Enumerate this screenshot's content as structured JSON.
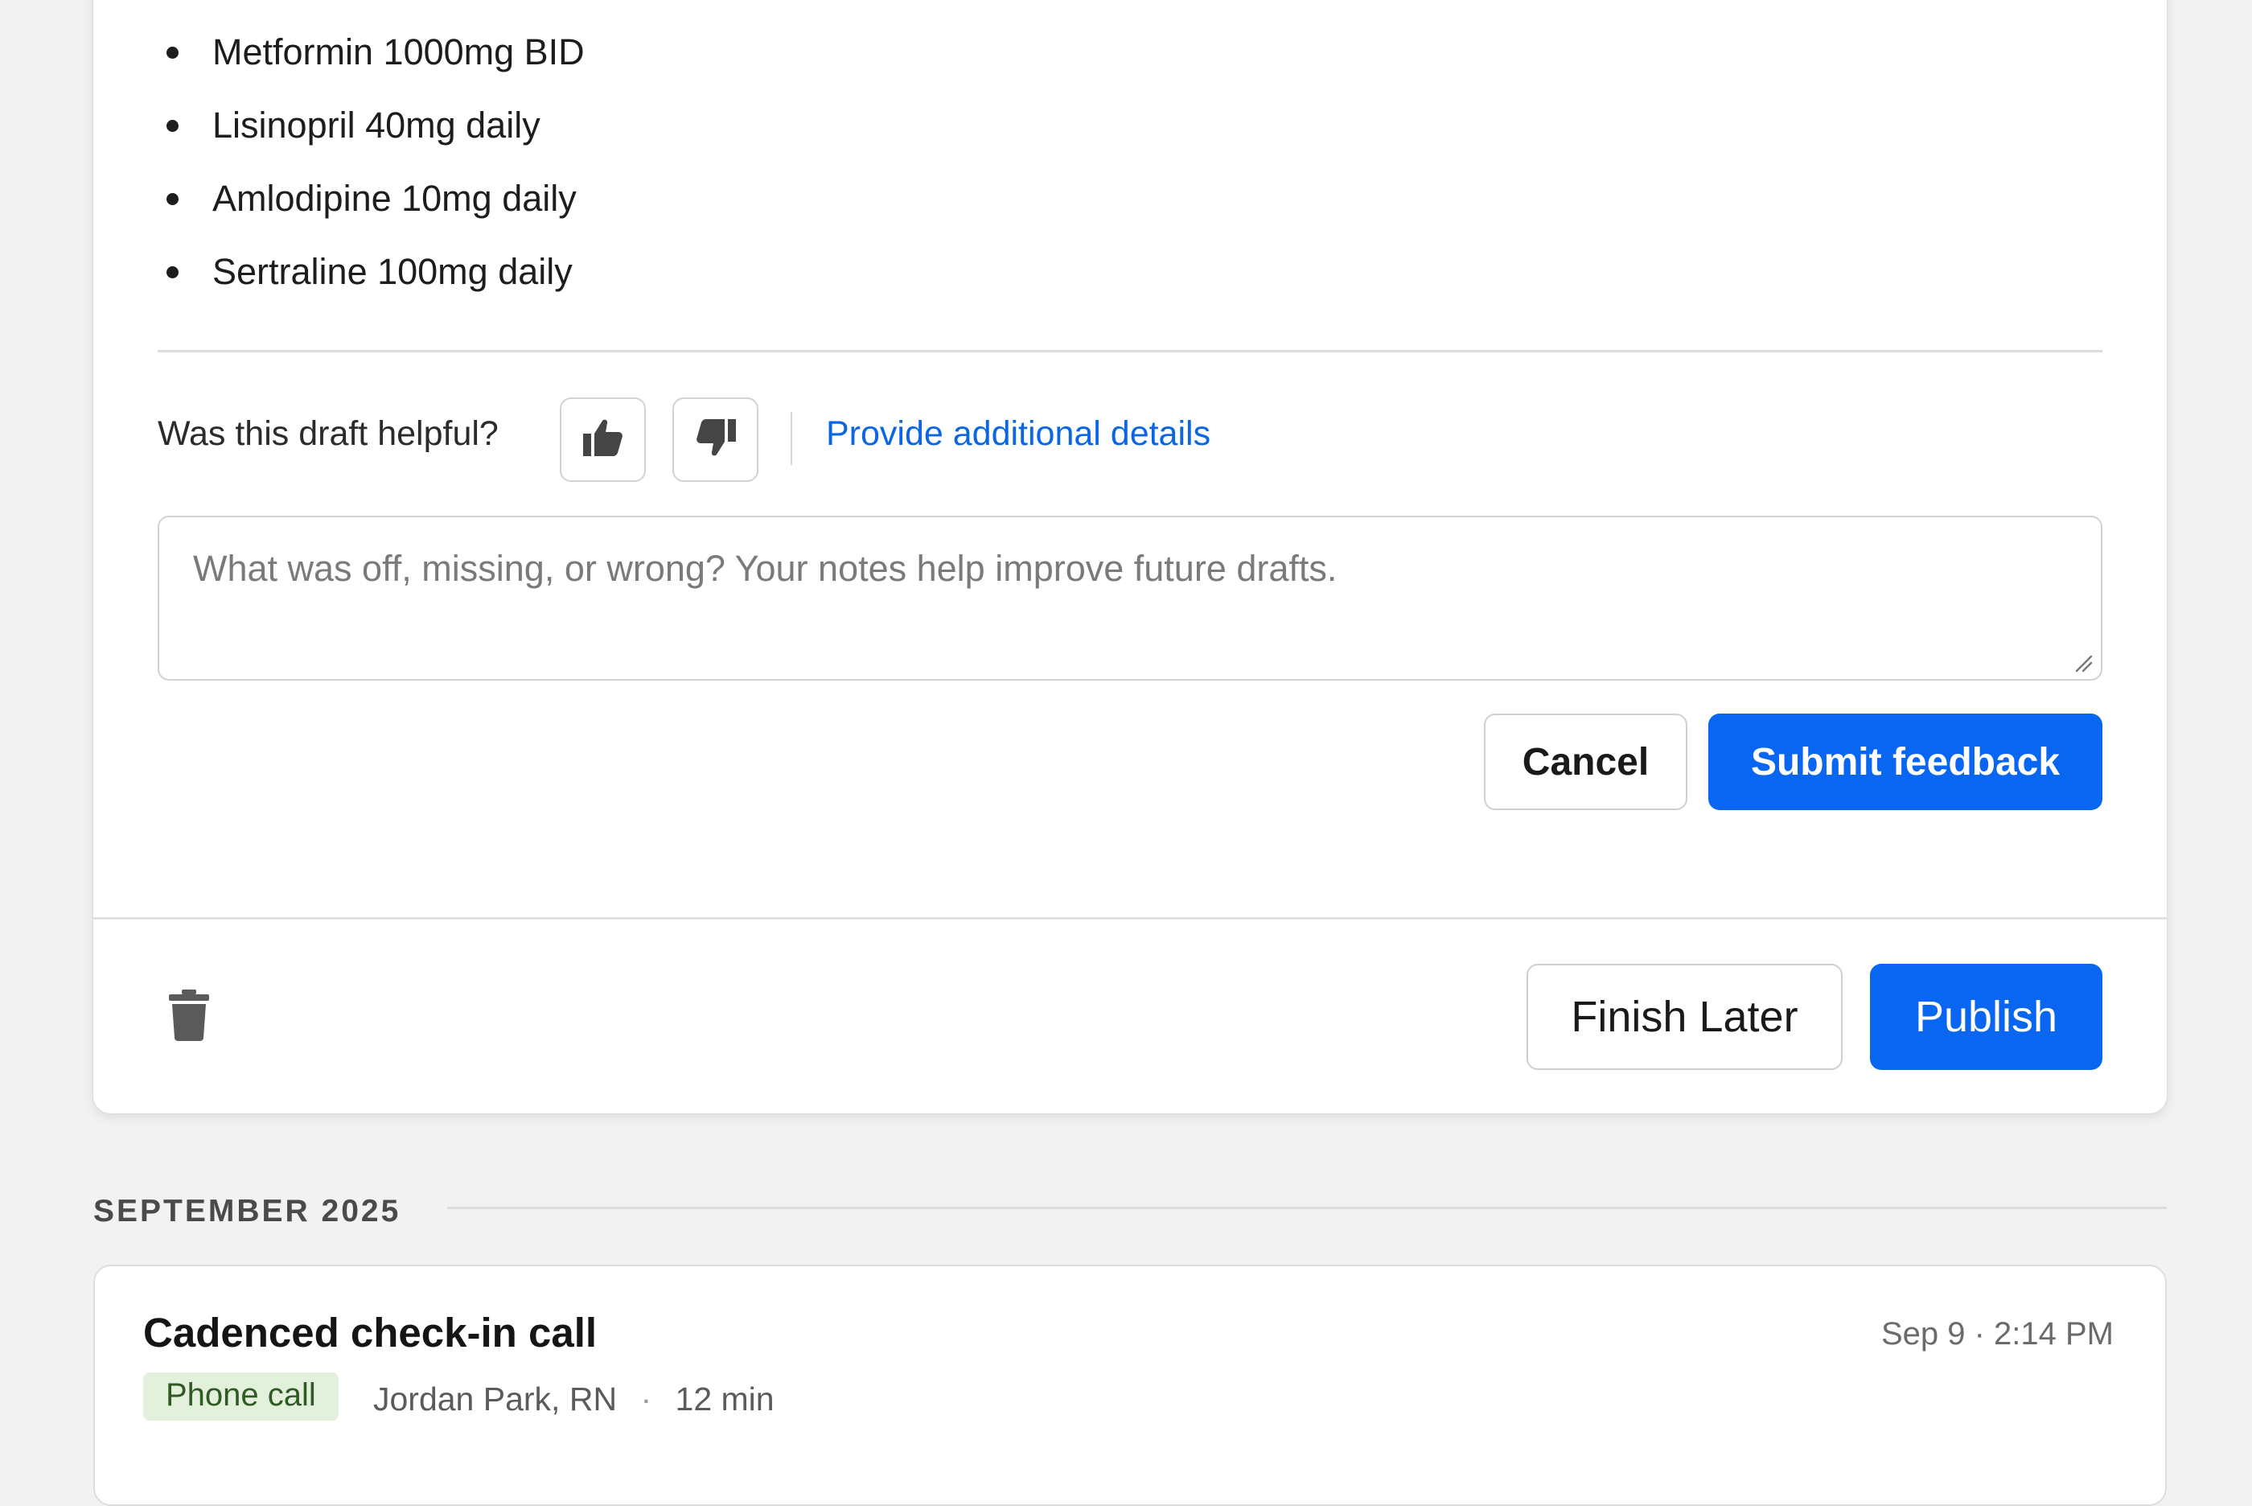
{
  "medications": [
    "Metformin 1000mg BID",
    "Lisinopril 40mg daily",
    "Amlodipine 10mg daily",
    "Sertraline 100mg daily"
  ],
  "feedback": {
    "question": "Was this draft helpful?",
    "details_link": "Provide additional details",
    "placeholder": "What was off, missing, or wrong? Your notes help improve future drafts.",
    "cancel_label": "Cancel",
    "submit_label": "Submit feedback"
  },
  "footer": {
    "finish_later_label": "Finish Later",
    "publish_label": "Publish"
  },
  "timeline": {
    "month_label": "SEPTEMBER 2025",
    "entries": [
      {
        "title": "Cadenced check-in call",
        "timestamp": "Sep 9 · 2:14 PM",
        "type_badge": "Phone call",
        "author": "Jordan Park, RN",
        "duration": "12 min"
      }
    ]
  },
  "colors": {
    "primary": "#0866f1",
    "link": "#0b66e4",
    "page_background": "#f2f2f2",
    "badge_background": "#e2f0dc"
  },
  "icons": [
    "thumbs-up-icon",
    "thumbs-down-icon",
    "trash-icon",
    "resize-grip-icon"
  ]
}
